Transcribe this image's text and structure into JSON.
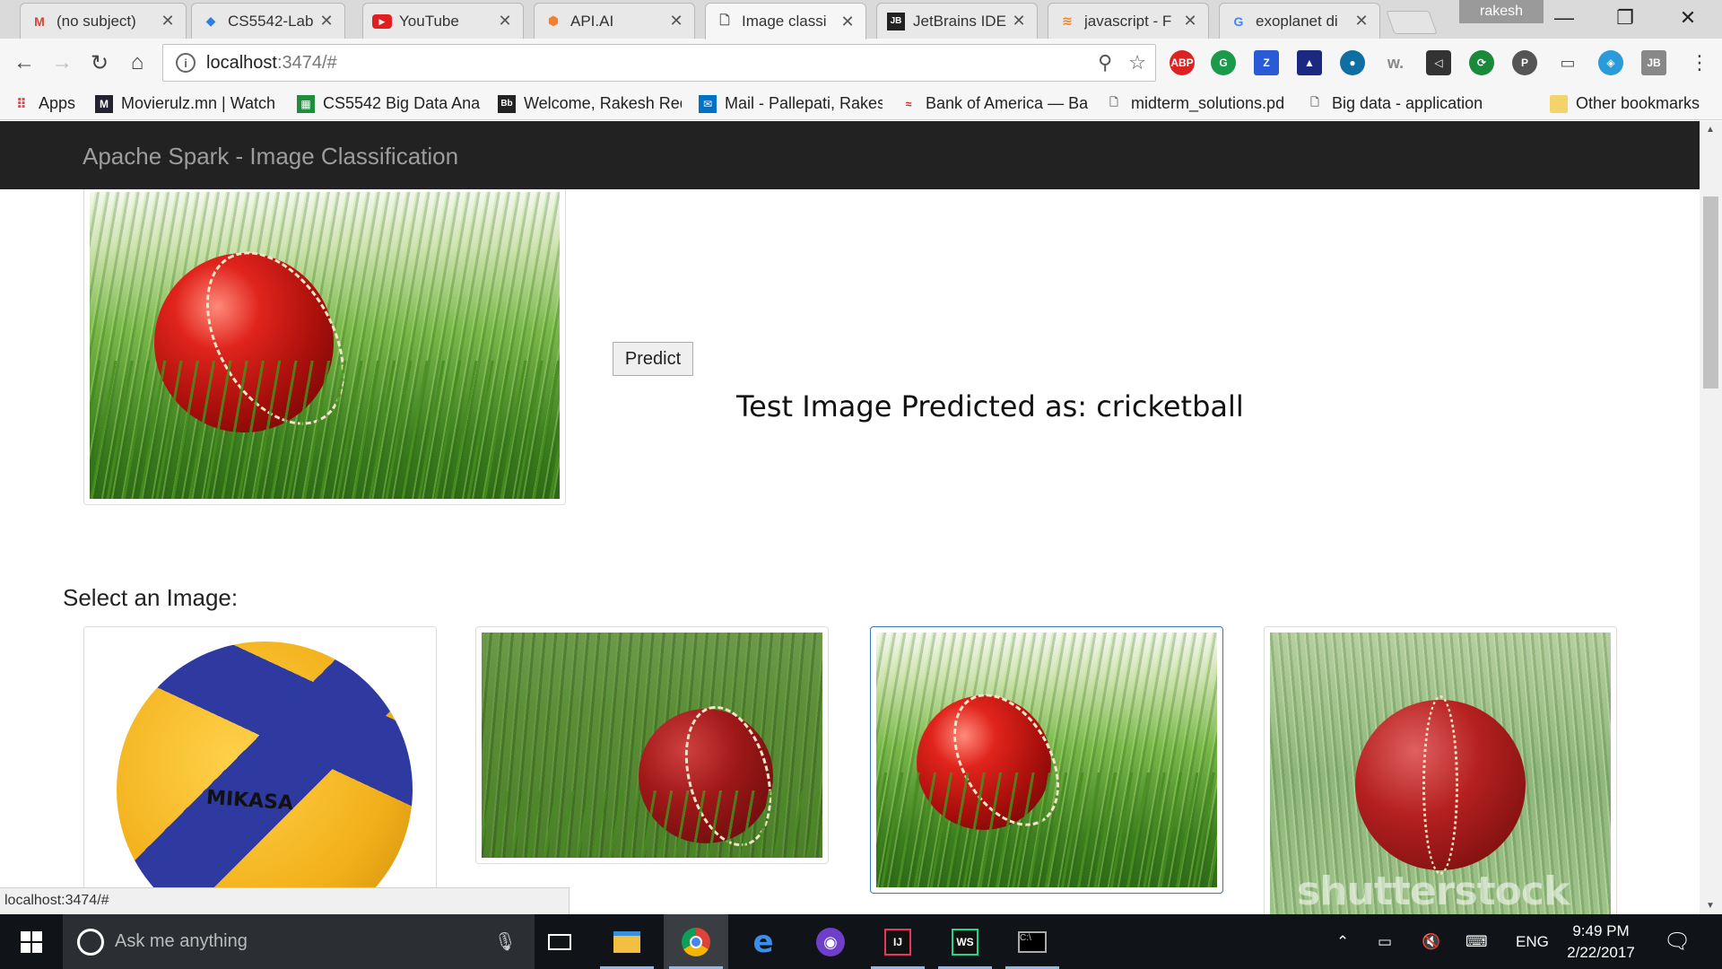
{
  "tabs": [
    {
      "title": "(no subject)",
      "icon": "gmail-icon"
    },
    {
      "title": "CS5542-Lab",
      "icon": "dropbox-icon"
    },
    {
      "title": "YouTube",
      "icon": "youtube-icon"
    },
    {
      "title": "API.AI",
      "icon": "api-ai-icon"
    },
    {
      "title": "Image classi",
      "icon": "page-icon"
    },
    {
      "title": "JetBrains IDE",
      "icon": "jetbrains-icon"
    },
    {
      "title": "javascript - F",
      "icon": "stackoverflow-icon"
    },
    {
      "title": "exoplanet di",
      "icon": "google-icon"
    }
  ],
  "profile_name": "rakesh",
  "address": {
    "host": "localhost",
    "rest": ":3474/#"
  },
  "bookmarks": [
    {
      "label": "Apps",
      "icon": "apps-grid-icon"
    },
    {
      "label": "Movierulz.mn | Watch",
      "icon": "movierulz-icon"
    },
    {
      "label": "CS5542 Big Data Anal",
      "icon": "sheets-icon"
    },
    {
      "label": "Welcome, Rakesh Red",
      "icon": "blackboard-icon"
    },
    {
      "label": "Mail - Pallepati, Rakes",
      "icon": "mail-icon"
    },
    {
      "label": "Bank of America — Ba",
      "icon": "bofa-icon"
    },
    {
      "label": "midterm_solutions.pd",
      "icon": "file-icon"
    },
    {
      "label": "Big data - application",
      "icon": "file-icon"
    }
  ],
  "other_bookmarks": "Other bookmarks",
  "page": {
    "brand": "Apache Spark - Image Classification",
    "predict_label": "Predict",
    "result_text": "Test Image Predicted as: cricketball",
    "select_label": "Select an Image:",
    "thumbnails": [
      {
        "subject": "volleyball",
        "brand_text": "MIKASA",
        "selected": false
      },
      {
        "subject": "cricket ball on grass",
        "selected": false
      },
      {
        "subject": "cricket ball in tall grass",
        "selected": true
      },
      {
        "subject": "cricket ball on pitch",
        "watermark": "shutterstock",
        "selected": false
      }
    ]
  },
  "status_url": "localhost:3474/#",
  "taskbar": {
    "search_placeholder": "Ask me anything",
    "language": "ENG",
    "time": "9:49 PM",
    "date": "2/22/2017"
  },
  "colors": {
    "navbar": "#222222",
    "brand_text": "#9d9d9d",
    "selected_border": "#337ab7"
  }
}
